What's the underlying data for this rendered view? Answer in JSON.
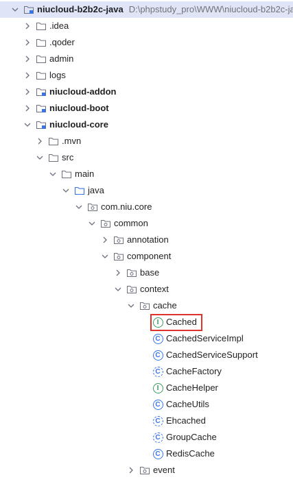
{
  "project": {
    "name": "niucloud-b2b2c-java",
    "path": "D:\\phpstudy_pro\\WWW\\niucloud-b2b2c-ja"
  },
  "tree": [
    {
      "label": ".idea",
      "icon": "folder"
    },
    {
      "label": ".qoder",
      "icon": "folder"
    },
    {
      "label": "admin",
      "icon": "folder"
    },
    {
      "label": "logs",
      "icon": "folder"
    },
    {
      "label": "niucloud-addon",
      "icon": "module-folder"
    },
    {
      "label": "niucloud-boot",
      "icon": "module-folder"
    },
    {
      "label": "niucloud-core",
      "icon": "module-folder"
    },
    {
      "label": ".mvn",
      "icon": "folder"
    },
    {
      "label": "src",
      "icon": "folder"
    },
    {
      "label": "main",
      "icon": "folder"
    },
    {
      "label": "java",
      "icon": "source-folder"
    },
    {
      "label": "com.niu.core",
      "icon": "package"
    },
    {
      "label": "common",
      "icon": "package"
    },
    {
      "label": "annotation",
      "icon": "package"
    },
    {
      "label": "component",
      "icon": "package"
    },
    {
      "label": "base",
      "icon": "package"
    },
    {
      "label": "context",
      "icon": "package"
    },
    {
      "label": "cache",
      "icon": "package"
    },
    {
      "label": "Cached",
      "icon": "annotation"
    },
    {
      "label": "CachedServiceImpl",
      "icon": "class"
    },
    {
      "label": "CachedServiceSupport",
      "icon": "class"
    },
    {
      "label": "CacheFactory",
      "icon": "abstract-class"
    },
    {
      "label": "CacheHelper",
      "icon": "interface"
    },
    {
      "label": "CacheUtils",
      "icon": "class"
    },
    {
      "label": "Ehcached",
      "icon": "abstract-class"
    },
    {
      "label": "GroupCache",
      "icon": "abstract-class"
    },
    {
      "label": "RedisCache",
      "icon": "class"
    },
    {
      "label": "event",
      "icon": "package"
    }
  ],
  "colors": {
    "selection": "#dfe5f6",
    "highlight": "#e0312b",
    "annotation": "#3a9b5c",
    "class": "#3574f0",
    "interface": "#3a9b5c"
  }
}
